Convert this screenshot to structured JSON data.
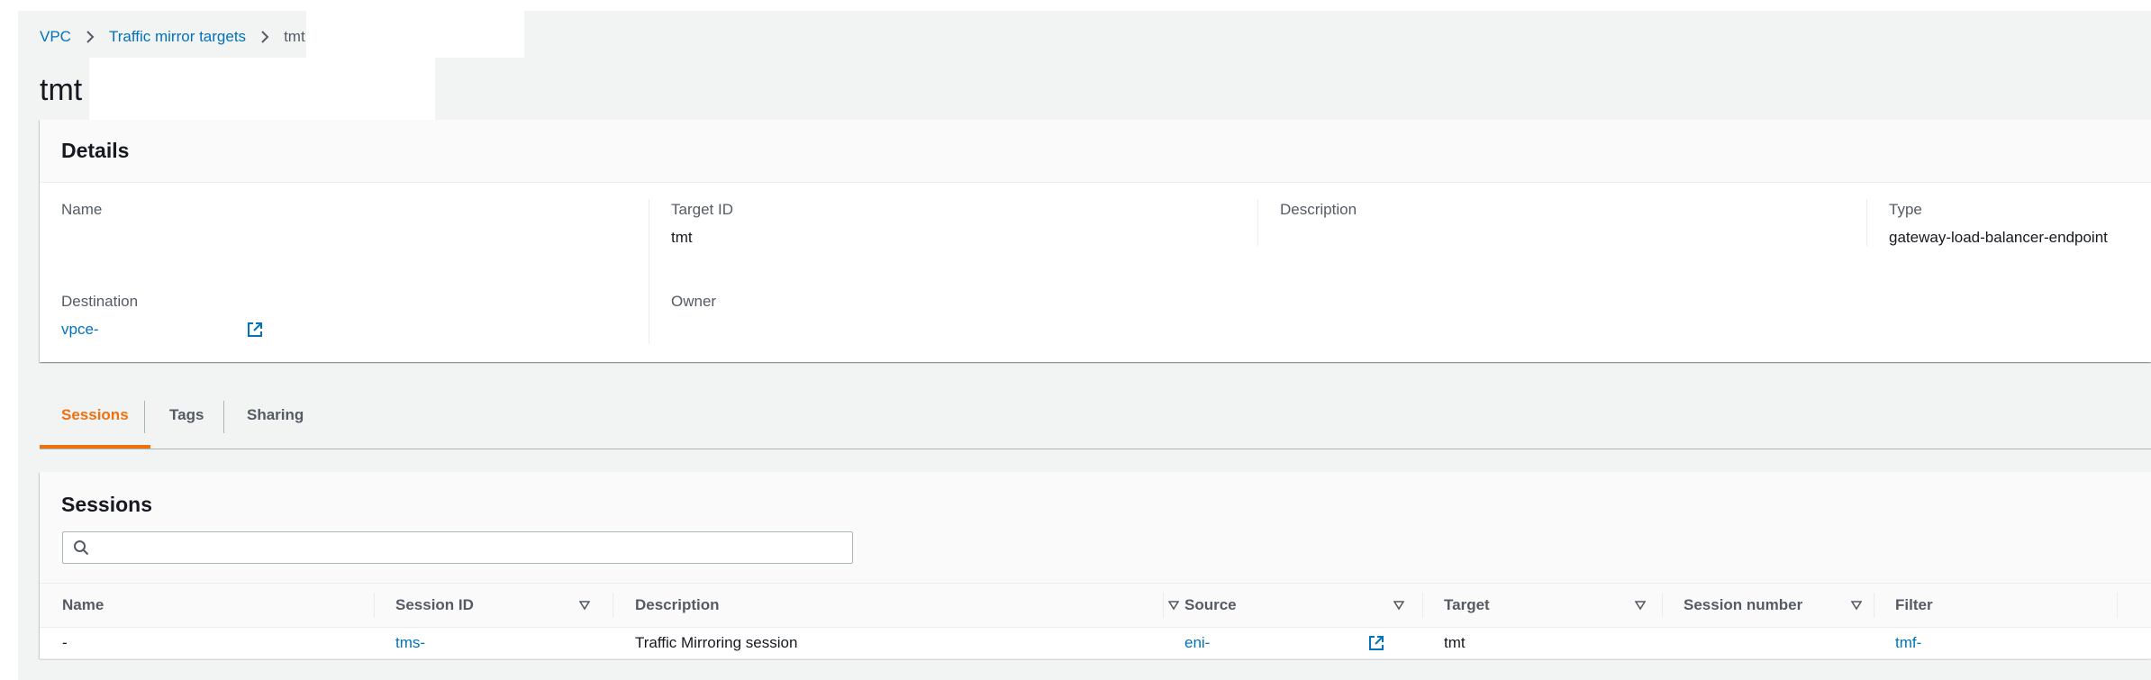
{
  "breadcrumb": {
    "items": [
      "VPC",
      "Traffic mirror targets"
    ],
    "current": "tmt"
  },
  "page_title": "tmt",
  "details": {
    "title": "Details",
    "fields": {
      "name": {
        "label": "Name",
        "value": ""
      },
      "target_id": {
        "label": "Target ID",
        "value": "tmt"
      },
      "description": {
        "label": "Description",
        "value": ""
      },
      "type": {
        "label": "Type",
        "value": "gateway-load-balancer-endpoint"
      },
      "destination": {
        "label": "Destination",
        "value": "vpce-"
      },
      "owner": {
        "label": "Owner",
        "value": ""
      }
    }
  },
  "tabs": [
    {
      "label": "Sessions",
      "active": true
    },
    {
      "label": "Tags",
      "active": false
    },
    {
      "label": "Sharing",
      "active": false
    }
  ],
  "sessions": {
    "title": "Sessions",
    "search": {
      "value": "",
      "placeholder": ""
    },
    "columns": [
      "Name",
      "Session ID",
      "Description",
      "Source",
      "Target",
      "Session number",
      "Filter"
    ],
    "rows": [
      {
        "name": "-",
        "session_id": "tms-",
        "description": "Traffic Mirroring session",
        "source": "eni-",
        "target": "tmt",
        "session_number": "",
        "filter": "tmf-"
      }
    ]
  },
  "colors": {
    "link": "#0073bb",
    "active_tab": "#ec7211",
    "background": "#f2f3f3",
    "text": "#16191f",
    "label": "#545b64"
  },
  "icons": [
    "chevron-right-icon",
    "external-link-icon",
    "search-icon",
    "sort-caret-icon"
  ]
}
